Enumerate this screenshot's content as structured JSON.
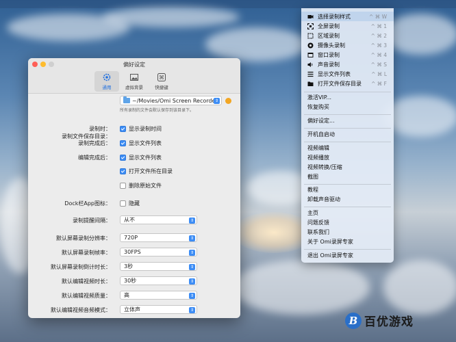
{
  "window": {
    "title": "偏好设定",
    "tabs": [
      {
        "label": "通用",
        "icon": "gear-icon",
        "active": true
      },
      {
        "label": "虚拟背景",
        "icon": "image-icon",
        "active": false
      },
      {
        "label": "快捷键",
        "icon": "command-icon",
        "active": false
      }
    ],
    "save_dir": {
      "label": "录制文件保存目录：",
      "path": "~/Movies/Omi Screen Recorder",
      "hint": "所有录制的文件会默认保存到该目录下。"
    },
    "during_recording": {
      "label": "录制时：",
      "option": "显示录制时间",
      "checked": true
    },
    "after_recording": {
      "label": "录制完成后：",
      "option": "显示文件列表",
      "checked": true
    },
    "after_editing": {
      "label": "编辑完成后：",
      "options": [
        {
          "text": "显示文件列表",
          "checked": true
        },
        {
          "text": "打开文件所在目录",
          "checked": true
        },
        {
          "text": "删除原始文件",
          "checked": false
        }
      ]
    },
    "dock_icon": {
      "label": "Dock栏App图标：",
      "option": "隐藏",
      "checked": false
    },
    "selects": [
      {
        "label": "录制提醒间隔：",
        "value": "从不"
      },
      {
        "label": "默认屏幕录制分辨率：",
        "value": "720P"
      },
      {
        "label": "默认屏幕录制帧率：",
        "value": "30FPS"
      },
      {
        "label": "默认屏幕录制倒计时长：",
        "value": "3秒"
      },
      {
        "label": "默认编辑视频时长：",
        "value": "30秒"
      },
      {
        "label": "默认编辑视频质量：",
        "value": "高"
      },
      {
        "label": "默认编辑视频音频模式：",
        "value": "立体声"
      }
    ]
  },
  "menu": {
    "record_items": [
      {
        "icon": "camera-icon",
        "label": "选择录制样式",
        "shortcut": "^ ⌘ W"
      },
      {
        "icon": "fullscreen-icon",
        "label": "全屏录制",
        "shortcut": "^ ⌘ 1"
      },
      {
        "icon": "region-icon",
        "label": "区域录制",
        "shortcut": "^ ⌘ 2"
      },
      {
        "icon": "webcam-icon",
        "label": "摄像头录制",
        "shortcut": "^ ⌘ 3"
      },
      {
        "icon": "window-icon",
        "label": "窗口录制",
        "shortcut": "^ ⌘ 4"
      },
      {
        "icon": "speaker-icon",
        "label": "声音录制",
        "shortcut": "^ ⌘ S"
      },
      {
        "icon": "list-icon",
        "label": "显示文件列表",
        "shortcut": "^ ⌘ L"
      },
      {
        "icon": "folder-icon",
        "label": "打开文件保存目录",
        "shortcut": "^ ⌘ F"
      }
    ],
    "group2": [
      "激活VIP...",
      "恢复购买"
    ],
    "group3": [
      "偏好设定..."
    ],
    "group4": [
      "开机自启动"
    ],
    "group5": [
      "视频编辑",
      "视频播放",
      "视频转换/压缩",
      "截图"
    ],
    "group6": [
      "教程",
      "卸载声音驱动"
    ],
    "group7": [
      "主页",
      "问题反馈",
      "联系我们",
      "关于 Omi录屏专家"
    ],
    "group8": [
      "退出 Omi录屏专家"
    ]
  },
  "watermark": {
    "logo_letter": "B",
    "text": "百优游戏"
  },
  "colors": {
    "accent": "#3d8df5",
    "menu_bg": "#e4ecf6",
    "window_bg": "#ececec"
  }
}
